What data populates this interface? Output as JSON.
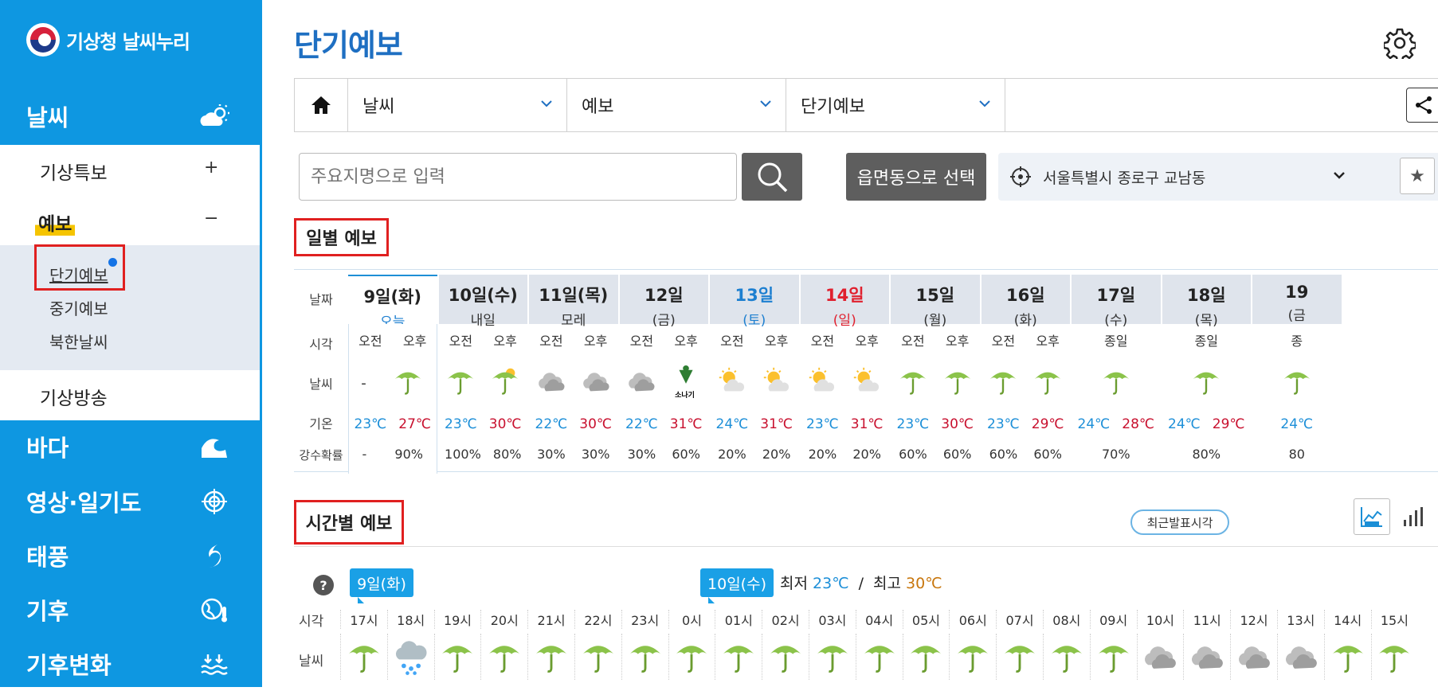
{
  "sidebar": {
    "logo_text": "기상청 날씨누리",
    "majors": [
      {
        "label": "날씨",
        "icon": "cloud-sun-icon"
      },
      {
        "label": "바다",
        "icon": "wave-icon"
      },
      {
        "label": "영상·일기도",
        "icon": "radar-icon"
      },
      {
        "label": "태풍",
        "icon": "typhoon-icon"
      },
      {
        "label": "기후",
        "icon": "globe-thermometer-icon"
      },
      {
        "label": "기후변화",
        "icon": "flood-icon"
      }
    ],
    "sub_items": [
      {
        "label": "기상특보",
        "toggle": "+"
      },
      {
        "label": "예보",
        "toggle": "−"
      },
      {
        "label": "기상방송"
      }
    ],
    "deep_items": [
      "단기예보",
      "중기예보",
      "북한날씨"
    ]
  },
  "header": {
    "title": "단기예보",
    "breadcrumb": [
      "날씨",
      "예보",
      "단기예보"
    ]
  },
  "search": {
    "placeholder": "주요지명으로 입력",
    "emd_button": "읍면동으로 선택",
    "location": "서울특별시 종로구 교남동"
  },
  "daily": {
    "title": "일별 예보",
    "row_labels": [
      "날짜",
      "시각",
      "날씨",
      "기온",
      "강수확률"
    ],
    "days": [
      {
        "date": "9일(화)",
        "sub": "오늘",
        "color": "today",
        "slots": [
          {
            "ampm": "오전",
            "wx": "none",
            "t": "23℃",
            "tc": "min",
            "pop": "-"
          },
          {
            "ampm": "오후",
            "wx": "umbrella",
            "t": "27℃",
            "tc": "max",
            "pop": "90%"
          }
        ]
      },
      {
        "date": "10일(수)",
        "sub": "내일",
        "color": "normal",
        "slots": [
          {
            "ampm": "오전",
            "wx": "umbrella",
            "t": "23℃",
            "tc": "min",
            "pop": "100%"
          },
          {
            "ampm": "오후",
            "wx": "umbrella-sun",
            "t": "30℃",
            "tc": "max",
            "pop": "80%"
          }
        ]
      },
      {
        "date": "11일(목)",
        "sub": "모레",
        "color": "normal",
        "slots": [
          {
            "ampm": "오전",
            "wx": "cloud",
            "t": "22℃",
            "tc": "min",
            "pop": "30%"
          },
          {
            "ampm": "오후",
            "wx": "cloud",
            "t": "30℃",
            "tc": "max",
            "pop": "30%"
          }
        ]
      },
      {
        "date": "12일",
        "sub": "(금)",
        "color": "normal",
        "slots": [
          {
            "ampm": "오전",
            "wx": "cloud",
            "t": "22℃",
            "tc": "min",
            "pop": "30%"
          },
          {
            "ampm": "오후",
            "wx": "shower",
            "t": "31℃",
            "tc": "max",
            "pop": "60%"
          }
        ]
      },
      {
        "date": "13일",
        "sub": "(토)",
        "color": "blue",
        "slots": [
          {
            "ampm": "오전",
            "wx": "sun-cloud",
            "t": "24℃",
            "tc": "min",
            "pop": "20%"
          },
          {
            "ampm": "오후",
            "wx": "sun-cloud",
            "t": "31℃",
            "tc": "max",
            "pop": "20%"
          }
        ]
      },
      {
        "date": "14일",
        "sub": "(일)",
        "color": "red",
        "slots": [
          {
            "ampm": "오전",
            "wx": "sun-cloud",
            "t": "23℃",
            "tc": "min",
            "pop": "20%"
          },
          {
            "ampm": "오후",
            "wx": "sun-cloud",
            "t": "31℃",
            "tc": "max",
            "pop": "20%"
          }
        ]
      },
      {
        "date": "15일",
        "sub": "(월)",
        "color": "normal",
        "slots": [
          {
            "ampm": "오전",
            "wx": "umbrella",
            "t": "23℃",
            "tc": "min",
            "pop": "60%"
          },
          {
            "ampm": "오후",
            "wx": "umbrella",
            "t": "30℃",
            "tc": "max",
            "pop": "60%"
          }
        ]
      },
      {
        "date": "16일",
        "sub": "(화)",
        "color": "normal",
        "slots": [
          {
            "ampm": "오전",
            "wx": "umbrella",
            "t": "23℃",
            "tc": "min",
            "pop": "60%"
          },
          {
            "ampm": "오후",
            "wx": "umbrella",
            "t": "29℃",
            "tc": "max",
            "pop": "60%"
          }
        ]
      },
      {
        "date": "17일",
        "sub": "(수)",
        "color": "normal",
        "allday": "종일",
        "wx": "umbrella",
        "tmin": "24℃",
        "tmax": "28℃",
        "pop": "70%"
      },
      {
        "date": "18일",
        "sub": "(목)",
        "color": "normal",
        "allday": "종일",
        "wx": "umbrella",
        "tmin": "24℃",
        "tmax": "29℃",
        "pop": "80%"
      },
      {
        "date": "19",
        "sub": "(금",
        "color": "normal",
        "allday": "종",
        "wx": "umbrella",
        "tmin": "24℃",
        "tmax": "",
        "pop": "80"
      }
    ],
    "shower_label": "소나기"
  },
  "hourly": {
    "title": "시간별 예보",
    "recent_button": "최근발표시각",
    "help": "?",
    "day_tags": [
      "9일(화)",
      "10일(수)"
    ],
    "minmax": {
      "min_label": "최저",
      "min": "23℃",
      "sep": "/",
      "max_label": "최고",
      "max": "30℃"
    },
    "row_labels": [
      "시각",
      "날씨"
    ],
    "hours": [
      "17시",
      "18시",
      "19시",
      "20시",
      "21시",
      "22시",
      "23시",
      "0시",
      "01시",
      "02시",
      "03시",
      "04시",
      "05시",
      "06시",
      "07시",
      "08시",
      "09시",
      "10시",
      "11시",
      "12시",
      "13시",
      "14시",
      "15시"
    ],
    "wx": [
      "umbrella",
      "cloud-rain",
      "umbrella",
      "umbrella",
      "umbrella",
      "umbrella",
      "umbrella",
      "umbrella",
      "umbrella",
      "umbrella",
      "umbrella",
      "umbrella",
      "umbrella",
      "umbrella",
      "umbrella",
      "umbrella",
      "umbrella",
      "cloud",
      "cloud",
      "cloud",
      "cloud",
      "umbrella",
      "umbrella"
    ]
  },
  "colors": {
    "sidebar": "#0e97e1",
    "accent": "#1e6fc2",
    "highlight": "#f5c400",
    "min_temp": "#1d8fd8",
    "max_temp": "#c8102e"
  }
}
